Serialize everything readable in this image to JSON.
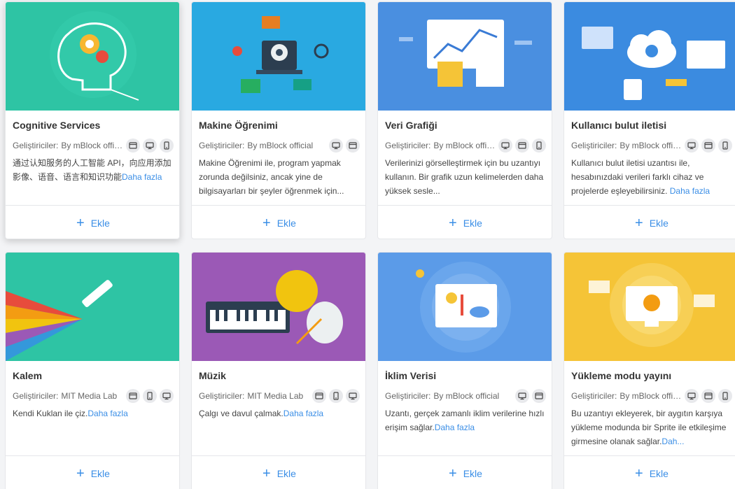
{
  "cards": [
    {
      "title": "Cognitive Services",
      "dev_label": "Geliştiriciler:",
      "dev_name": "By mBlock official",
      "platforms": [
        "window-icon",
        "desktop-icon",
        "mobile-icon"
      ],
      "desc": "通过认知服务的人工智能 API，向应用添加影像、语音、语言和知识功能",
      "more": "Daha fazla",
      "add_label": "Ekle",
      "banner_color": "#2ec4a4"
    },
    {
      "title": "Makine Öğrenimi",
      "dev_label": "Geliştiriciler:",
      "dev_name": "By mBlock official",
      "platforms": [
        "desktop-icon",
        "window-icon"
      ],
      "desc": "Makine Öğrenimi ile, program yapmak zorunda değilsiniz, ancak yine de bilgisayarları bir şeyler öğrenmek için...",
      "more": "",
      "add_label": "Ekle",
      "banner_color": "#29a9e1"
    },
    {
      "title": "Veri Grafiği",
      "dev_label": "Geliştiriciler:",
      "dev_name": "By mBlock official",
      "platforms": [
        "desktop-icon",
        "window-icon",
        "mobile-icon"
      ],
      "desc": "Verilerinizi görselleştirmek için bu uzantıyı kullanın. Bir grafik uzun kelimelerden daha yüksek sesle...",
      "more": "",
      "add_label": "Ekle",
      "banner_color": "#4a8fe0"
    },
    {
      "title": "Kullanıcı bulut iletisi",
      "dev_label": "Geliştiriciler:",
      "dev_name": "By mBlock official",
      "platforms": [
        "desktop-icon",
        "window-icon",
        "mobile-icon"
      ],
      "desc": "Kullanıcı bulut iletisi uzantısı ile, hesabınızdaki verileri farklı cihaz ve projelerde eşleyebilirsiniz. ",
      "more": "Daha fazla",
      "add_label": "Ekle",
      "banner_color": "#3b8be0"
    },
    {
      "title": "Kalem",
      "dev_label": "Geliştiriciler:",
      "dev_name": "MIT Media Lab",
      "platforms": [
        "window-icon",
        "mobile-icon",
        "desktop-icon"
      ],
      "desc": "Kendi Kuklan ile çiz.",
      "more": "Daha fazla",
      "add_label": "Ekle",
      "banner_color": "#2ec4a4"
    },
    {
      "title": "Müzik",
      "dev_label": "Geliştiriciler:",
      "dev_name": "MIT Media Lab",
      "platforms": [
        "window-icon",
        "mobile-icon",
        "desktop-icon"
      ],
      "desc": "Çalgı ve davul çalmak.",
      "more": "Daha fazla",
      "add_label": "Ekle",
      "banner_color": "#9b59b6"
    },
    {
      "title": "İklim Verisi",
      "dev_label": "Geliştiriciler:",
      "dev_name": "By mBlock official",
      "platforms": [
        "desktop-icon",
        "window-icon"
      ],
      "desc": "Uzantı, gerçek zamanlı iklim verilerine hızlı erişim sağlar.",
      "more": "Daha fazla",
      "add_label": "Ekle",
      "banner_color": "#5b9be8"
    },
    {
      "title": "Yükleme modu yayını",
      "dev_label": "Geliştiriciler:",
      "dev_name": "By mBlock official",
      "platforms": [
        "desktop-icon",
        "window-icon",
        "mobile-icon"
      ],
      "desc": "Bu uzantıyı ekleyerek, bir aygıtın karşıya yükleme modunda bir Sprite ile etkileşime girmesine olanak sağlar.",
      "more": "Dah...",
      "add_label": "Ekle",
      "banner_color": "#f5c437"
    }
  ]
}
